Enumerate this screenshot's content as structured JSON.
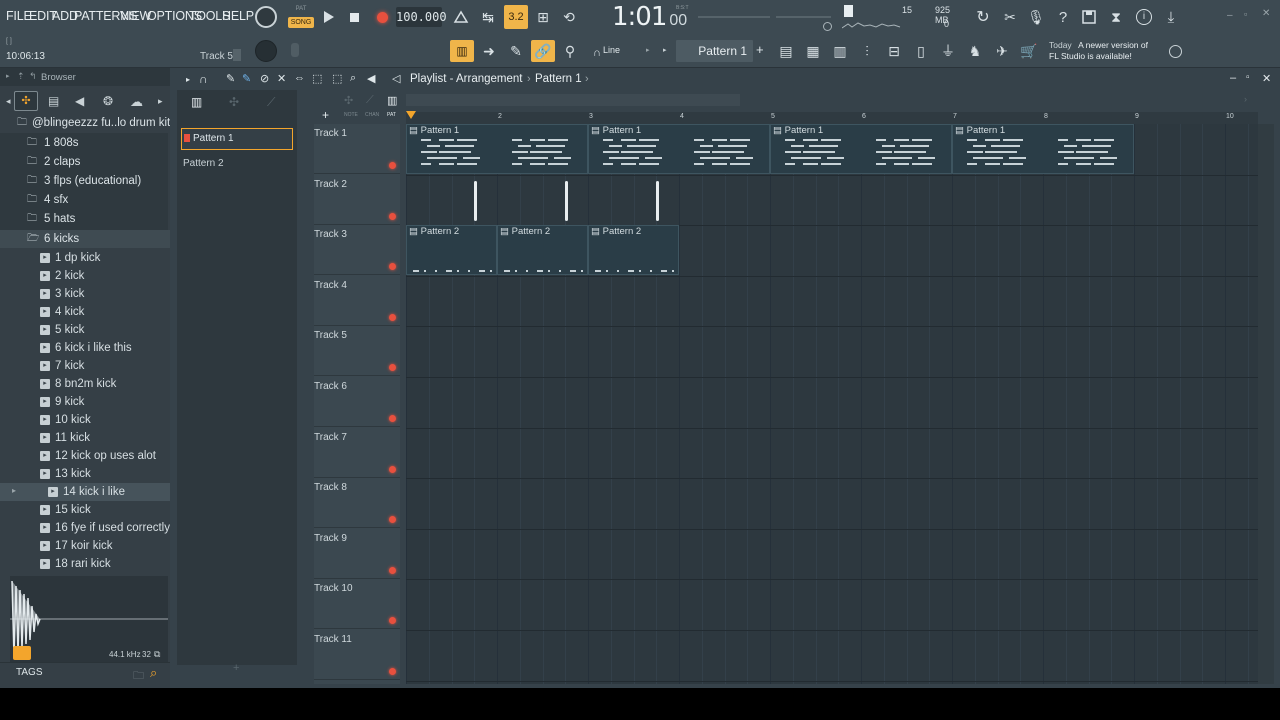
{
  "menu": [
    "FILE",
    "EDIT",
    "ADD",
    "PATTERNS",
    "VIEW",
    "OPTIONS",
    "TOOLS",
    "HELP"
  ],
  "mode": {
    "pat": "PAT",
    "song": "SONG"
  },
  "tempo": "100.000",
  "clock": {
    "main": "1:01",
    "sub": "00",
    "label": "B:S:T"
  },
  "cpu": {
    "voices": "15",
    "ram": "925 MB",
    "zero": "0"
  },
  "hint": {
    "time": "10:06:13",
    "track": "Track 5",
    "bracket": "[ ]"
  },
  "snap": "Line",
  "pattern_selector": "Pattern 1",
  "news": {
    "when": "Today",
    "line1": "A newer version of",
    "line2": "FL Studio is available!"
  },
  "browser": {
    "title": "Browser",
    "root": "@blingeezzz fu..lo drum kit 2",
    "folders": [
      "1 808s",
      "2 claps",
      "3 flps (educational)",
      "4 sfx",
      "5 hats",
      "6 kicks"
    ],
    "files": [
      "1 dp kick",
      "2 kick",
      "3 kick",
      "4 kick",
      "5 kick",
      "6 kick i like this",
      "7 kick",
      "8 bn2m kick",
      "9 kick",
      "10 kick",
      "11 kick",
      "12 kick op uses alot",
      "13 kick",
      "14 kick i like",
      "15 kick",
      "16 fye if used correctly",
      "17 koir kick",
      "18 rari kick"
    ],
    "selected_file": "14 kick i like",
    "sample_rate": "44.1 kHz",
    "bits": "32",
    "tags": "TAGS"
  },
  "picker": [
    "Pattern 1",
    "Pattern 2"
  ],
  "playlist": {
    "title": "Playlist - Arrangement",
    "crumb": "Pattern 1",
    "ruler_marks": [
      "2",
      "3",
      "4",
      "5",
      "6",
      "7",
      "8",
      "9",
      "10"
    ],
    "tracks": [
      "Track 1",
      "Track 2",
      "Track 3",
      "Track 4",
      "Track 5",
      "Track 6",
      "Track 7",
      "Track 8",
      "Track 9",
      "Track 10",
      "Track 11"
    ],
    "clip_names": {
      "p1": "Pattern 1",
      "p2": "Pattern 2"
    },
    "mini": {
      "note": "NOTE",
      "chan": "CHAN",
      "pat": "PAT"
    }
  },
  "colors": {
    "accent": "#f3a52c",
    "record": "#e8503e",
    "clip": "#2a3d47"
  }
}
